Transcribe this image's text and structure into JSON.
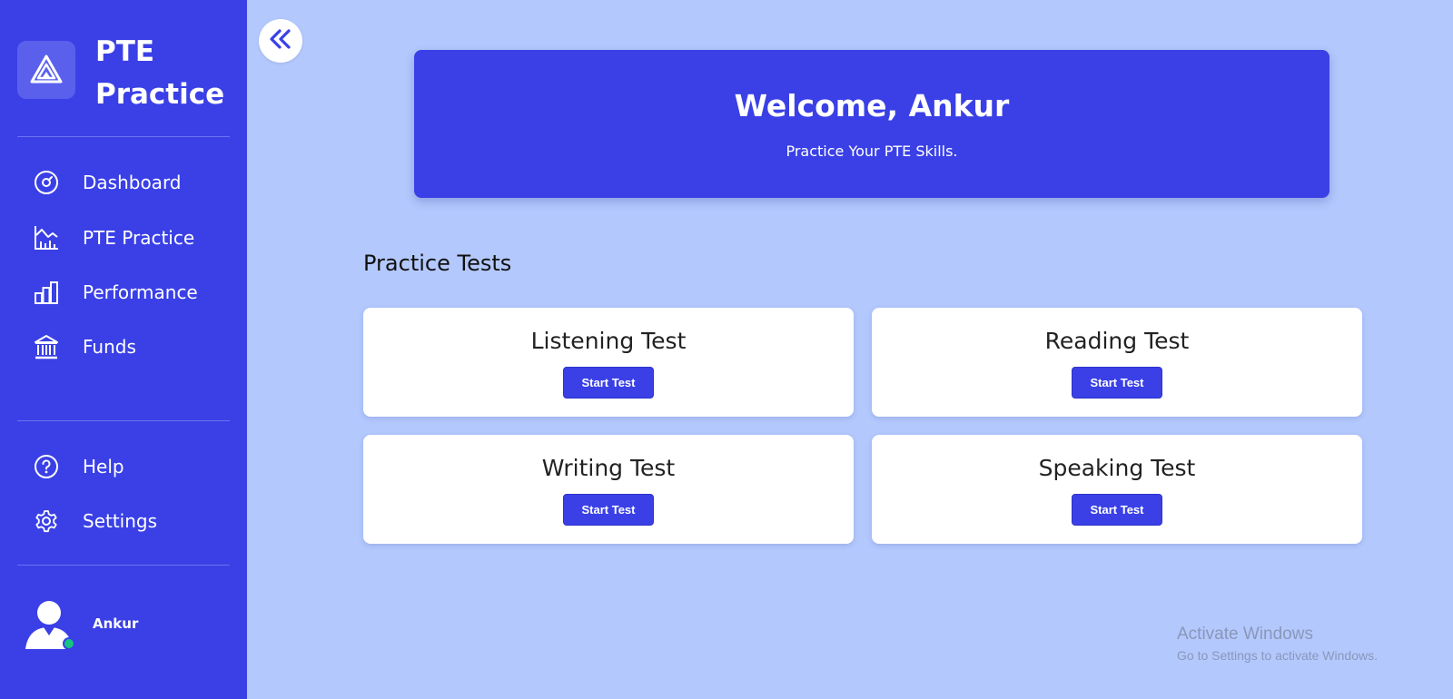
{
  "brand": {
    "name": "PTE\nPractice",
    "logo_icon": "triangle-logo-icon"
  },
  "sidebar": {
    "nav_items": [
      {
        "label": "Dashboard",
        "icon": "gauge-icon"
      },
      {
        "label": "PTE Practice",
        "icon": "chart-line-icon"
      },
      {
        "label": "Performance",
        "icon": "bar-chart-icon"
      },
      {
        "label": "Funds",
        "icon": "bank-icon"
      }
    ],
    "secondary_items": [
      {
        "label": "Help",
        "icon": "help-circle-icon"
      },
      {
        "label": "Settings",
        "icon": "gear-icon"
      }
    ],
    "user": {
      "name": "Ankur",
      "status": "online"
    }
  },
  "collapse_icon": "chevrons-left-icon",
  "welcome": {
    "title": "Welcome, Ankur",
    "subtitle": "Practice Your PTE Skills."
  },
  "practice": {
    "title": "Practice Tests",
    "tests": [
      {
        "name": "Listening Test",
        "button": "Start Test"
      },
      {
        "name": "Reading Test",
        "button": "Start Test"
      },
      {
        "name": "Writing Test",
        "button": "Start Test"
      },
      {
        "name": "Speaking Test",
        "button": "Start Test"
      }
    ]
  },
  "watermark": {
    "title": "Activate Windows",
    "subtitle": "Go to Settings to activate Windows."
  },
  "colors": {
    "primary": "#3a40e6",
    "background": "#b3c8fd",
    "card": "#ffffff",
    "online": "#16c47f"
  }
}
